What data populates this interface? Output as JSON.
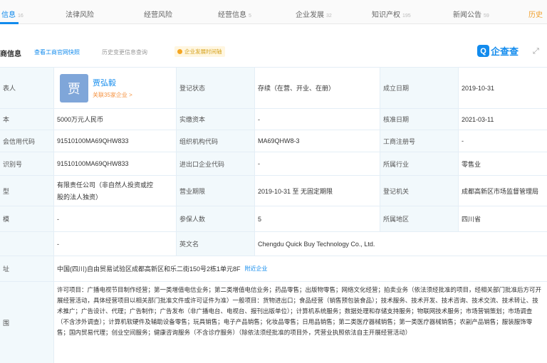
{
  "tabs": [
    {
      "label": "信息",
      "count": "16"
    },
    {
      "label": "法律风险",
      "count": ""
    },
    {
      "label": "经营风险",
      "count": ""
    },
    {
      "label": "经营信息",
      "count": "5"
    },
    {
      "label": "企业发展",
      "count": "32"
    },
    {
      "label": "知识产权",
      "count": "195"
    },
    {
      "label": "新闻公告",
      "count": "59"
    },
    {
      "label": "历史",
      "count": ""
    }
  ],
  "section": {
    "title": "商信息",
    "link_report": "查看工商官网快照",
    "link_history": "历史变更信息查询",
    "badge": "企业发展时间轴",
    "logo_text": "企查查"
  },
  "rows": {
    "r1": {
      "l1": "表人",
      "l2": "登记状态",
      "v2": "存续（在营、开业、在册）",
      "l3": "成立日期",
      "v3": "2019-10-31"
    },
    "legal_rep": {
      "avatar_char": "贾",
      "name": "贾弘毅",
      "relation": "关联35家企业 >"
    },
    "r2": {
      "l1": "本",
      "v1": "5000万元人民币",
      "l2": "实缴资本",
      "v2": "-",
      "l3": "核准日期",
      "v3": "2021-03-11"
    },
    "r3": {
      "l1": "会信用代码",
      "v1": "91510100MA69QHW833",
      "l2": "组织机构代码",
      "v2": "MA69QHW8-3",
      "l3": "工商注册号",
      "v3": "-"
    },
    "r4": {
      "l1": "识别号",
      "v1": "91510100MA69QHW833",
      "l2": "进出口企业代码",
      "v2": "-",
      "l3": "所属行业",
      "v3": "零售业"
    },
    "r5": {
      "l1": "型",
      "v1a": "有限责任公司（非自然人投资或控",
      "v1b": "股的法人独资）",
      "l2": "营业期限",
      "v2": "2019-10-31 至 无固定期限",
      "l3": "登记机关",
      "v3": "成都高新区市场监督管理局"
    },
    "r6": {
      "l1": "模",
      "v1": "-",
      "l2": "参保人数",
      "v2": "5",
      "l3": "所属地区",
      "v3": "四川省"
    },
    "r7": {
      "l1": "",
      "v1": "-",
      "l2": "英文名",
      "v2": "Chengdu Quick Buy Technology Co., Ltd."
    },
    "r8": {
      "l1": "址",
      "v1": "中国(四川)自由贸易试验区成都高新区和乐二街150号2栋1单元8F",
      "link": "附近企业"
    },
    "r9": {
      "l1": "围",
      "v1": "许可项目：广播电视节目制作经营；第一类增值电信业务；第二类增值电信业务；药品零售；出版物零售；网络文化经营；拍卖业务（依法须经批准的项目，经相关部门批准后方可开展经营活动，具体经营项目以相关部门批准文件或许可证件为准）一般项目：货物进出口；食品经营（销售预包装食品）；技术服务、技术开发、技术咨询、技术交流、技术转让、技术推广；广告设计、代理；广告制作；广告发布（非广播电台、电视台、报刊出版单位）；计算机系统服务；数据处理和存储支持服务；物联网技术服务；市场营销策划；市场调查（不含涉外调查）；计算机软硬件及辅助设备零售；玩具销售；电子产品销售；化妆品零售；日用品销售；第二类医疗器械销售；第一类医疗器械销售；农副产品销售；服装服饰零售；国内贸易代理；创业空间服务；健康咨询服务（不含诊疗服务）（除依法须经批准的项目外，凭营业执照依法自主开展经营活动）"
    }
  },
  "colors": {
    "accent": "#128bed",
    "label_bg": "#f2f9fc",
    "relation": "#f5903d"
  }
}
